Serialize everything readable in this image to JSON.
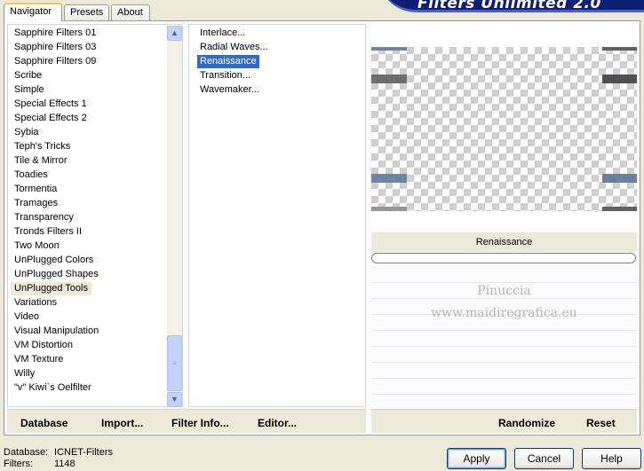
{
  "tabs": [
    "Navigator",
    "Presets",
    "About"
  ],
  "app_title": "Filters Unlimited 2.0",
  "categories": [
    "Sapphire Filters 01",
    "Sapphire Filters 03",
    "Sapphire Filters 09",
    "Scribe",
    "Simple",
    "Special Effects 1",
    "Special Effects 2",
    "Sybia",
    "Teph's Tricks",
    "Tile & Mirror",
    "Toadies",
    "Tormentia",
    "Tramages",
    "Transparency",
    "Tronds Filters II",
    "Two Moon",
    "UnPlugged Colors",
    "UnPlugged Shapes",
    "UnPlugged Tools",
    "Variations",
    "Video",
    "Visual Manipulation",
    "VM Distortion",
    "VM Texture",
    "Willy",
    "\"v\" Kiwi`s Oelfilter"
  ],
  "selected_category": "UnPlugged Tools",
  "filters": [
    "Interlace...",
    "Radial Waves...",
    "Renaissance",
    "Transition...",
    "Wavemaker..."
  ],
  "selected_filter": "Renaissance",
  "filter_name": "Renaissance",
  "watermark": {
    "line1": "Pinuccia",
    "line2": "www.maidiregrafica.eu"
  },
  "bottom_left_buttons": [
    "Database",
    "Import...",
    "Filter Info...",
    "Editor..."
  ],
  "bottom_right_buttons": [
    "Randomize",
    "Reset"
  ],
  "status": {
    "database_label": "Database:",
    "database_value": "ICNET-Filters",
    "filters_label": "Filters:",
    "filters_value": "1148"
  },
  "dialog_buttons": {
    "apply": "Apply",
    "cancel": "Cancel",
    "help": "Help"
  },
  "colors": {
    "accent": "#316ac5",
    "banner": "#0f1f74",
    "tab_highlight": "#ffc83c"
  },
  "preview_bar_colors": {
    "gray_dark": "#5f6064",
    "slate_blue": "#6e84a3",
    "mauve": "#9d9499"
  }
}
